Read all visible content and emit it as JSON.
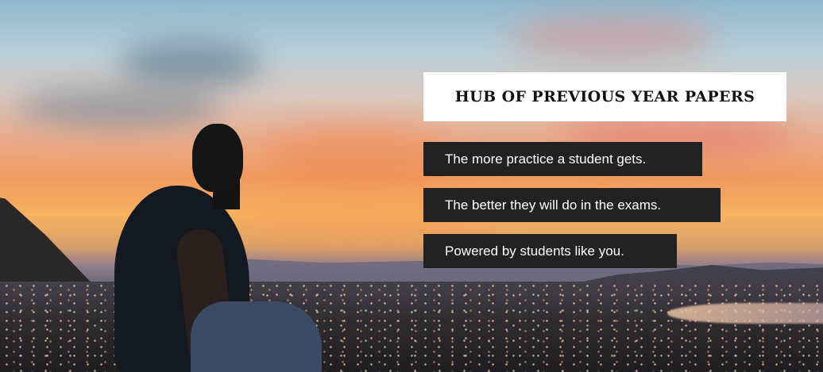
{
  "hero": {
    "title": "HUB OF PREVIOUS YEAR PAPERS",
    "taglines": [
      "The more practice a student gets.",
      "The better they will do in the exams.",
      "Powered by students like you."
    ]
  }
}
